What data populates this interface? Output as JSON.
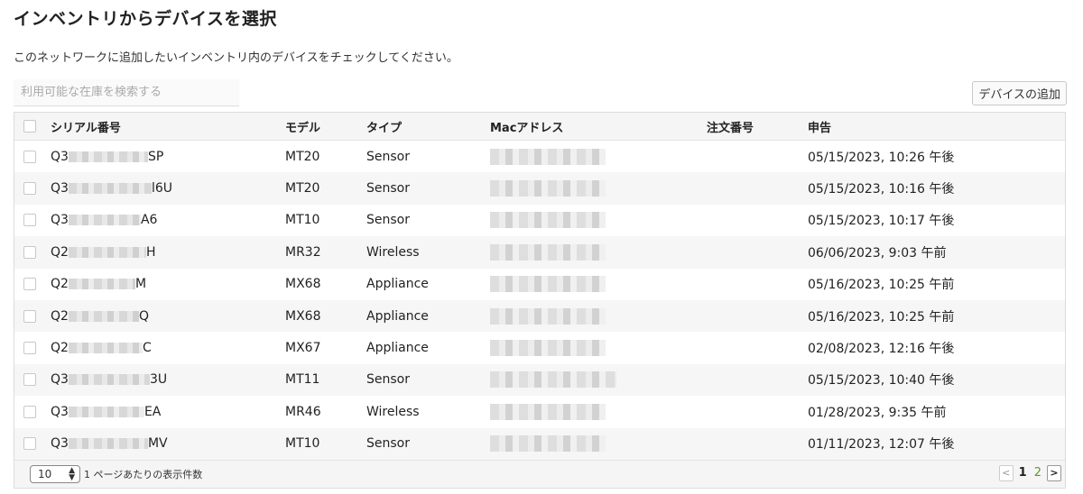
{
  "page": {
    "title": "インベントリからデバイスを選択",
    "subtitle": "このネットワークに追加したいインベントリ内のデバイスをチェックしてください。"
  },
  "search": {
    "placeholder": "利用可能な在庫を検索する",
    "value": ""
  },
  "actions": {
    "add_devices_label": "デバイスの追加"
  },
  "table": {
    "headers": {
      "serial": "シリアル番号",
      "model": "モデル",
      "type": "タイプ",
      "mac": "Macアドレス",
      "order": "注文番号",
      "report": "申告"
    },
    "rows": [
      {
        "serial_prefix": "Q3",
        "serial_suffix": "SP",
        "model": "MT20",
        "type": "Sensor",
        "order": "",
        "report": "05/15/2023, 10:26 午後"
      },
      {
        "serial_prefix": "Q3",
        "serial_suffix": "l6U",
        "model": "MT20",
        "type": "Sensor",
        "order": "",
        "report": "05/15/2023, 10:16 午後"
      },
      {
        "serial_prefix": "Q3",
        "serial_suffix": "A6",
        "model": "MT10",
        "type": "Sensor",
        "order": "",
        "report": "05/15/2023, 10:17 午後"
      },
      {
        "serial_prefix": "Q2",
        "serial_suffix": "H",
        "model": "MR32",
        "type": "Wireless",
        "order": "",
        "report": "06/06/2023, 9:03 午前"
      },
      {
        "serial_prefix": "Q2",
        "serial_suffix": "M",
        "model": "MX68",
        "type": "Appliance",
        "order": "",
        "report": "05/16/2023, 10:25 午前"
      },
      {
        "serial_prefix": "Q2",
        "serial_suffix": "Q",
        "model": "MX68",
        "type": "Appliance",
        "order": "",
        "report": "05/16/2023, 10:25 午前"
      },
      {
        "serial_prefix": "Q2",
        "serial_suffix": "C",
        "model": "MX67",
        "type": "Appliance",
        "order": "",
        "report": "02/08/2023, 12:16 午後"
      },
      {
        "serial_prefix": "Q3",
        "serial_suffix": "3U",
        "model": "MT11",
        "type": "Sensor",
        "order": "",
        "report": "05/15/2023, 10:40 午後"
      },
      {
        "serial_prefix": "Q3",
        "serial_suffix": "EA",
        "model": "MR46",
        "type": "Wireless",
        "order": "",
        "report": "01/28/2023, 9:35 午前"
      },
      {
        "serial_prefix": "Q3",
        "serial_suffix": "MV",
        "model": "MT10",
        "type": "Sensor",
        "order": "",
        "report": "01/11/2023, 12:07 午後"
      }
    ]
  },
  "footer": {
    "per_page_value": "10",
    "per_page_label": "1 ページあたりの表示件数",
    "pages": [
      "1",
      "2"
    ],
    "current_page": "1",
    "prev_icon": "chevron-left-icon",
    "next_icon": "chevron-right-icon",
    "prev_glyph": "<",
    "next_glyph": ">"
  },
  "colors": {
    "link_green": "#5a9a2a",
    "header_bg": "#f5f5f5",
    "alt_row_bg": "#f6f6f6"
  }
}
